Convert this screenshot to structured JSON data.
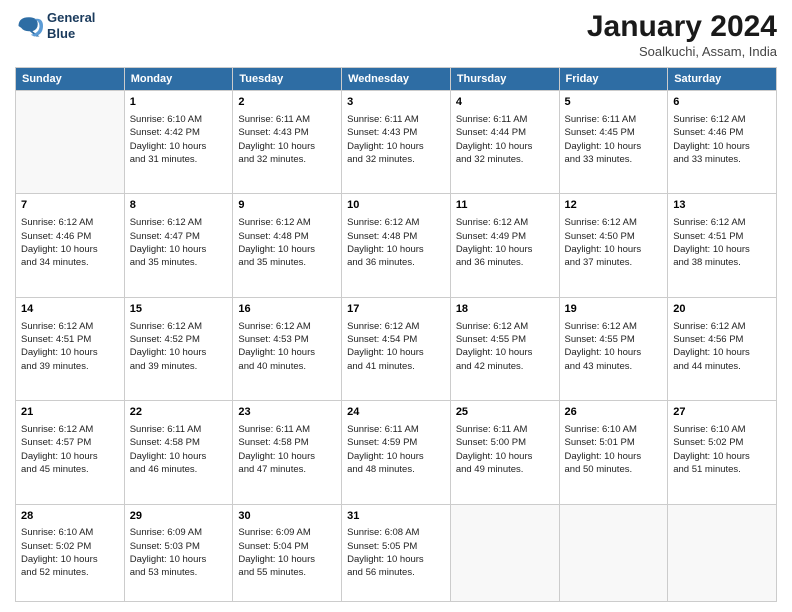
{
  "logo": {
    "line1": "General",
    "line2": "Blue"
  },
  "title": "January 2024",
  "subtitle": "Soalkuchi, Assam, India",
  "weekdays": [
    "Sunday",
    "Monday",
    "Tuesday",
    "Wednesday",
    "Thursday",
    "Friday",
    "Saturday"
  ],
  "weeks": [
    [
      {
        "day": "",
        "info": ""
      },
      {
        "day": "1",
        "info": "Sunrise: 6:10 AM\nSunset: 4:42 PM\nDaylight: 10 hours\nand 31 minutes."
      },
      {
        "day": "2",
        "info": "Sunrise: 6:11 AM\nSunset: 4:43 PM\nDaylight: 10 hours\nand 32 minutes."
      },
      {
        "day": "3",
        "info": "Sunrise: 6:11 AM\nSunset: 4:43 PM\nDaylight: 10 hours\nand 32 minutes."
      },
      {
        "day": "4",
        "info": "Sunrise: 6:11 AM\nSunset: 4:44 PM\nDaylight: 10 hours\nand 32 minutes."
      },
      {
        "day": "5",
        "info": "Sunrise: 6:11 AM\nSunset: 4:45 PM\nDaylight: 10 hours\nand 33 minutes."
      },
      {
        "day": "6",
        "info": "Sunrise: 6:12 AM\nSunset: 4:46 PM\nDaylight: 10 hours\nand 33 minutes."
      }
    ],
    [
      {
        "day": "7",
        "info": "Sunrise: 6:12 AM\nSunset: 4:46 PM\nDaylight: 10 hours\nand 34 minutes."
      },
      {
        "day": "8",
        "info": "Sunrise: 6:12 AM\nSunset: 4:47 PM\nDaylight: 10 hours\nand 35 minutes."
      },
      {
        "day": "9",
        "info": "Sunrise: 6:12 AM\nSunset: 4:48 PM\nDaylight: 10 hours\nand 35 minutes."
      },
      {
        "day": "10",
        "info": "Sunrise: 6:12 AM\nSunset: 4:48 PM\nDaylight: 10 hours\nand 36 minutes."
      },
      {
        "day": "11",
        "info": "Sunrise: 6:12 AM\nSunset: 4:49 PM\nDaylight: 10 hours\nand 36 minutes."
      },
      {
        "day": "12",
        "info": "Sunrise: 6:12 AM\nSunset: 4:50 PM\nDaylight: 10 hours\nand 37 minutes."
      },
      {
        "day": "13",
        "info": "Sunrise: 6:12 AM\nSunset: 4:51 PM\nDaylight: 10 hours\nand 38 minutes."
      }
    ],
    [
      {
        "day": "14",
        "info": "Sunrise: 6:12 AM\nSunset: 4:51 PM\nDaylight: 10 hours\nand 39 minutes."
      },
      {
        "day": "15",
        "info": "Sunrise: 6:12 AM\nSunset: 4:52 PM\nDaylight: 10 hours\nand 39 minutes."
      },
      {
        "day": "16",
        "info": "Sunrise: 6:12 AM\nSunset: 4:53 PM\nDaylight: 10 hours\nand 40 minutes."
      },
      {
        "day": "17",
        "info": "Sunrise: 6:12 AM\nSunset: 4:54 PM\nDaylight: 10 hours\nand 41 minutes."
      },
      {
        "day": "18",
        "info": "Sunrise: 6:12 AM\nSunset: 4:55 PM\nDaylight: 10 hours\nand 42 minutes."
      },
      {
        "day": "19",
        "info": "Sunrise: 6:12 AM\nSunset: 4:55 PM\nDaylight: 10 hours\nand 43 minutes."
      },
      {
        "day": "20",
        "info": "Sunrise: 6:12 AM\nSunset: 4:56 PM\nDaylight: 10 hours\nand 44 minutes."
      }
    ],
    [
      {
        "day": "21",
        "info": "Sunrise: 6:12 AM\nSunset: 4:57 PM\nDaylight: 10 hours\nand 45 minutes."
      },
      {
        "day": "22",
        "info": "Sunrise: 6:11 AM\nSunset: 4:58 PM\nDaylight: 10 hours\nand 46 minutes."
      },
      {
        "day": "23",
        "info": "Sunrise: 6:11 AM\nSunset: 4:58 PM\nDaylight: 10 hours\nand 47 minutes."
      },
      {
        "day": "24",
        "info": "Sunrise: 6:11 AM\nSunset: 4:59 PM\nDaylight: 10 hours\nand 48 minutes."
      },
      {
        "day": "25",
        "info": "Sunrise: 6:11 AM\nSunset: 5:00 PM\nDaylight: 10 hours\nand 49 minutes."
      },
      {
        "day": "26",
        "info": "Sunrise: 6:10 AM\nSunset: 5:01 PM\nDaylight: 10 hours\nand 50 minutes."
      },
      {
        "day": "27",
        "info": "Sunrise: 6:10 AM\nSunset: 5:02 PM\nDaylight: 10 hours\nand 51 minutes."
      }
    ],
    [
      {
        "day": "28",
        "info": "Sunrise: 6:10 AM\nSunset: 5:02 PM\nDaylight: 10 hours\nand 52 minutes."
      },
      {
        "day": "29",
        "info": "Sunrise: 6:09 AM\nSunset: 5:03 PM\nDaylight: 10 hours\nand 53 minutes."
      },
      {
        "day": "30",
        "info": "Sunrise: 6:09 AM\nSunset: 5:04 PM\nDaylight: 10 hours\nand 55 minutes."
      },
      {
        "day": "31",
        "info": "Sunrise: 6:08 AM\nSunset: 5:05 PM\nDaylight: 10 hours\nand 56 minutes."
      },
      {
        "day": "",
        "info": ""
      },
      {
        "day": "",
        "info": ""
      },
      {
        "day": "",
        "info": ""
      }
    ]
  ]
}
